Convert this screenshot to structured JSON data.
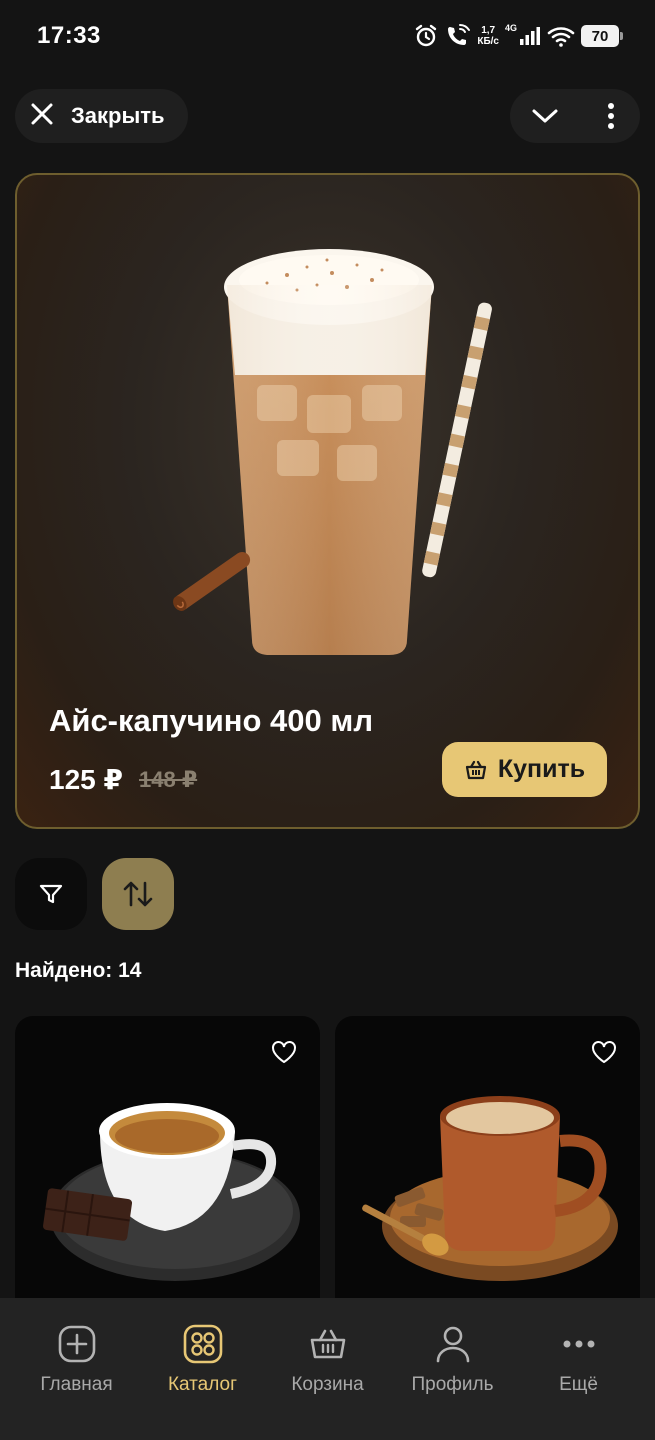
{
  "status_bar": {
    "time": "17:33",
    "net_speed_value": "1,7",
    "net_speed_unit": "КБ/с",
    "network": "4G",
    "battery": "70",
    "icons": [
      "alarm-icon",
      "wifi-call-icon",
      "signal-icon",
      "wifi-icon",
      "battery-icon"
    ]
  },
  "header": {
    "close_label": "Закрыть",
    "icons": [
      "close-icon",
      "chevron-down-icon",
      "more-vertical-icon"
    ]
  },
  "hero": {
    "title": "Айс-капучино 400 мл",
    "price": "125 ₽",
    "old_price": "148 ₽",
    "buy_label": "Купить",
    "colors": {
      "accent": "#e7c775",
      "border": "#6e5e2e"
    }
  },
  "filters": {
    "icons": [
      "filter-icon",
      "sort-icon"
    ],
    "found_text": "Найдено: 14"
  },
  "products": [
    {
      "name": "espresso",
      "icon": "heart-icon"
    },
    {
      "name": "cocoa-mug",
      "icon": "heart-icon"
    }
  ],
  "bottom_nav": {
    "items": [
      {
        "label": "Главная",
        "icon": "home-plus-icon",
        "active": false
      },
      {
        "label": "Каталог",
        "icon": "catalog-grid-icon",
        "active": true
      },
      {
        "label": "Корзина",
        "icon": "basket-icon",
        "active": false
      },
      {
        "label": "Профиль",
        "icon": "profile-icon",
        "active": false
      },
      {
        "label": "Ещё",
        "icon": "more-horizontal-icon",
        "active": false
      }
    ]
  }
}
